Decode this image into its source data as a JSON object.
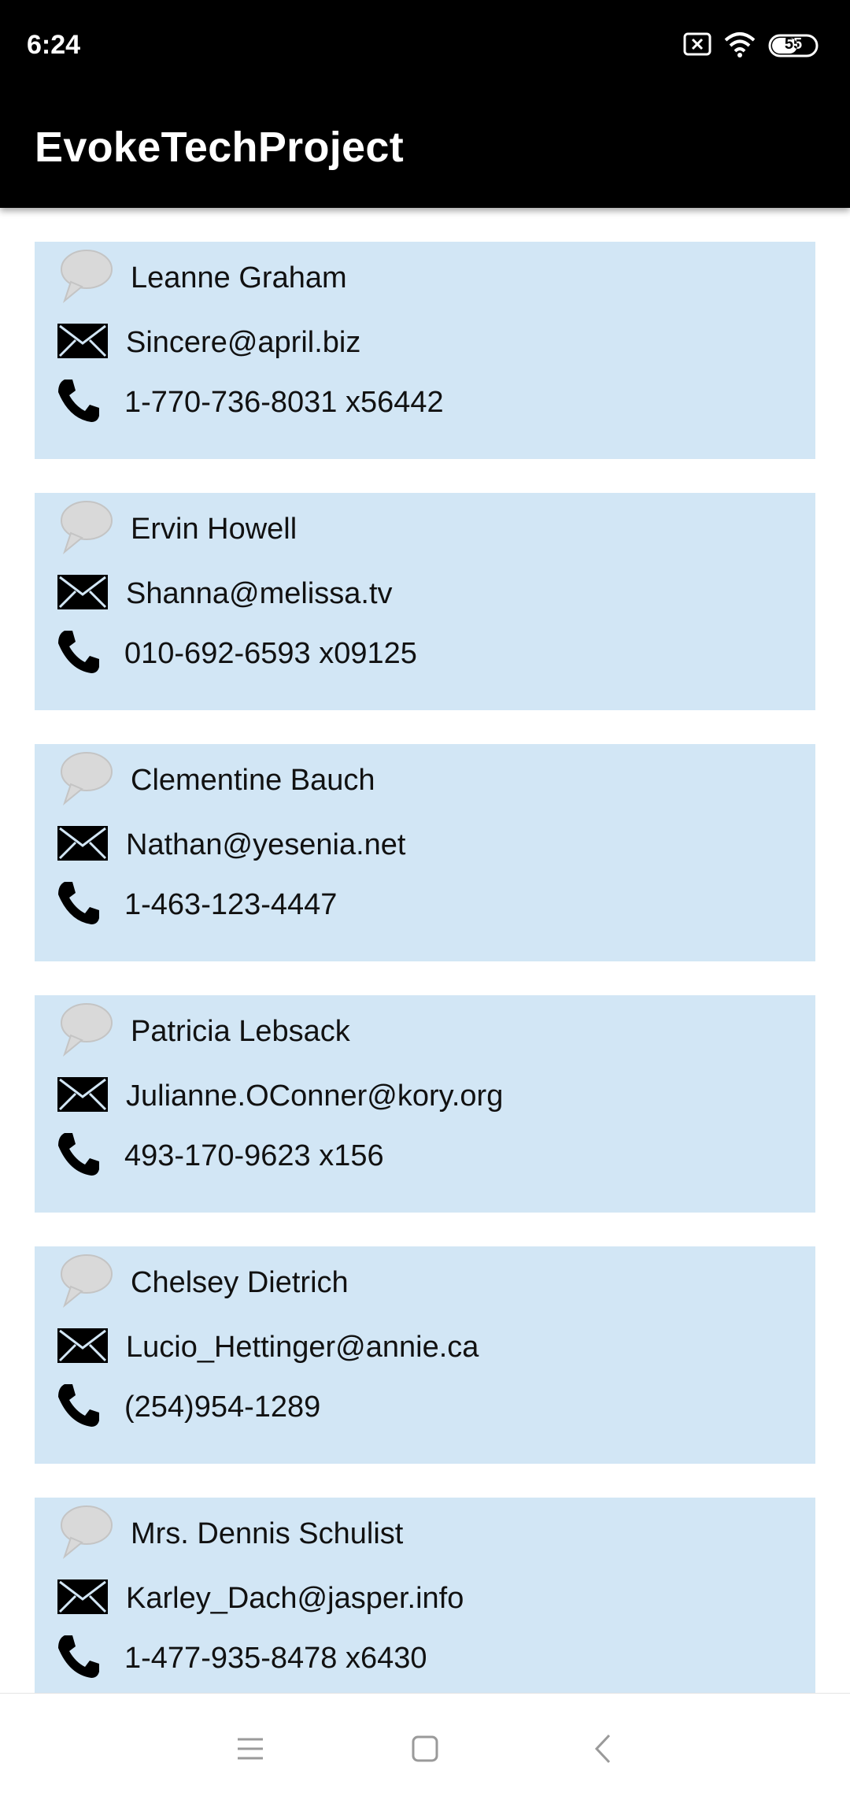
{
  "status_bar": {
    "time": "6:24",
    "battery": "55"
  },
  "app_bar": {
    "title": "EvokeTechProject"
  },
  "contacts": [
    {
      "name": "Leanne Graham",
      "email": "Sincere@april.biz",
      "phone": "1-770-736-8031 x56442"
    },
    {
      "name": "Ervin Howell",
      "email": "Shanna@melissa.tv",
      "phone": "010-692-6593 x09125"
    },
    {
      "name": "Clementine Bauch",
      "email": "Nathan@yesenia.net",
      "phone": "1-463-123-4447"
    },
    {
      "name": "Patricia Lebsack",
      "email": "Julianne.OConner@kory.org",
      "phone": "493-170-9623 x156"
    },
    {
      "name": "Chelsey Dietrich",
      "email": "Lucio_Hettinger@annie.ca",
      "phone": "(254)954-1289"
    },
    {
      "name": "Mrs. Dennis Schulist",
      "email": "Karley_Dach@jasper.info",
      "phone": "1-477-935-8478 x6430"
    }
  ],
  "colors": {
    "card_background": "#d2e6f5",
    "bar_background": "#000000"
  }
}
